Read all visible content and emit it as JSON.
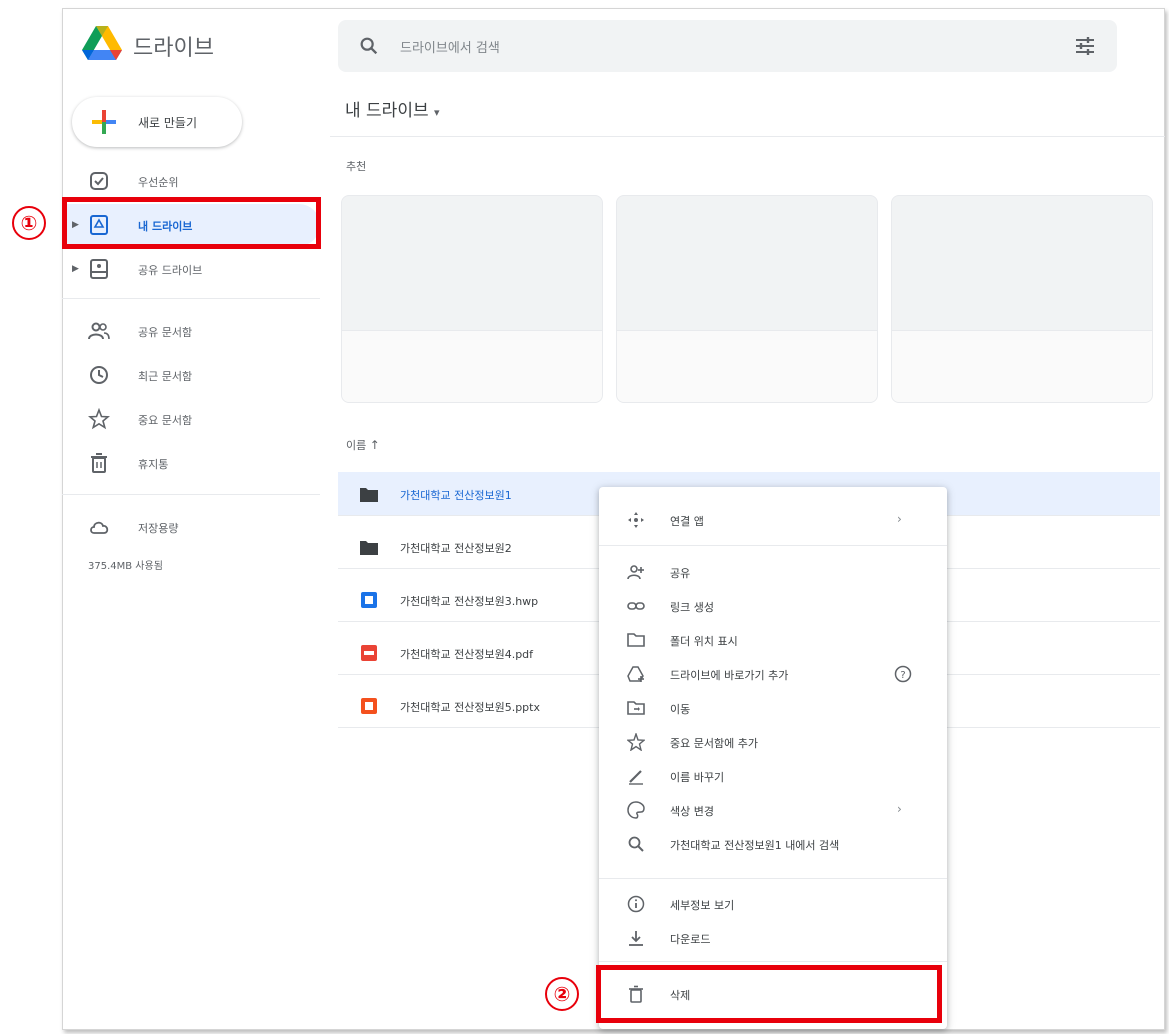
{
  "header": {
    "app_title": "드라이브",
    "search_placeholder": "드라이브에서 검색"
  },
  "sidebar": {
    "new_button": "새로 만들기",
    "items": [
      {
        "label": "우선순위",
        "icon": "priority-icon"
      },
      {
        "label": "내 드라이브",
        "icon": "my-drive-icon",
        "active": true
      },
      {
        "label": "공유 드라이브",
        "icon": "shared-drive-icon"
      },
      {
        "label": "공유 문서함",
        "icon": "shared-with-me-icon"
      },
      {
        "label": "최근 문서함",
        "icon": "recent-icon"
      },
      {
        "label": "중요 문서함",
        "icon": "star-icon"
      },
      {
        "label": "휴지통",
        "icon": "trash-icon"
      },
      {
        "label": "저장용량",
        "icon": "cloud-icon"
      }
    ],
    "storage_text": "375.4MB 사용됨"
  },
  "main": {
    "breadcrumb": "내 드라이브",
    "suggested_label": "추천",
    "sort_label": "이름",
    "files": [
      {
        "name": "가천대학교 전산정보원1",
        "type": "folder",
        "color": "#3c4043"
      },
      {
        "name": "가천대학교 전산정보원2",
        "type": "folder",
        "color": "#3c4043"
      },
      {
        "name": "가천대학교 전산정보원3.hwp",
        "type": "hwp",
        "color": "#1a73e8"
      },
      {
        "name": "가천대학교 전산정보원4.pdf",
        "type": "pdf",
        "color": "#ea4335"
      },
      {
        "name": "가천대학교 전산정보원5.pptx",
        "type": "pptx",
        "color": "#f4511e"
      }
    ]
  },
  "context_menu": {
    "items": [
      {
        "label": "연결 앱",
        "icon": "apps-icon",
        "submenu": true
      },
      {
        "label": "공유",
        "icon": "share-person-icon"
      },
      {
        "label": "링크 생성",
        "icon": "link-icon"
      },
      {
        "label": "폴더 위치 표시",
        "icon": "folder-outline-icon"
      },
      {
        "label": "드라이브에 바로가기 추가",
        "icon": "add-shortcut-icon",
        "help": true
      },
      {
        "label": "이동",
        "icon": "move-icon"
      },
      {
        "label": "중요 문서함에 추가",
        "icon": "star-outline-icon"
      },
      {
        "label": "이름 바꾸기",
        "icon": "rename-icon"
      },
      {
        "label": "색상 변경",
        "icon": "palette-icon",
        "submenu": true
      },
      {
        "label": "가천대학교 전산정보원1 내에서 검색",
        "icon": "search-icon"
      },
      {
        "label": "세부정보 보기",
        "icon": "info-icon"
      },
      {
        "label": "다운로드",
        "icon": "download-icon"
      },
      {
        "label": "삭제",
        "icon": "delete-icon"
      }
    ]
  },
  "annotations": {
    "step1": "①",
    "step2": "②",
    "highlight_color": "#e8000b"
  }
}
